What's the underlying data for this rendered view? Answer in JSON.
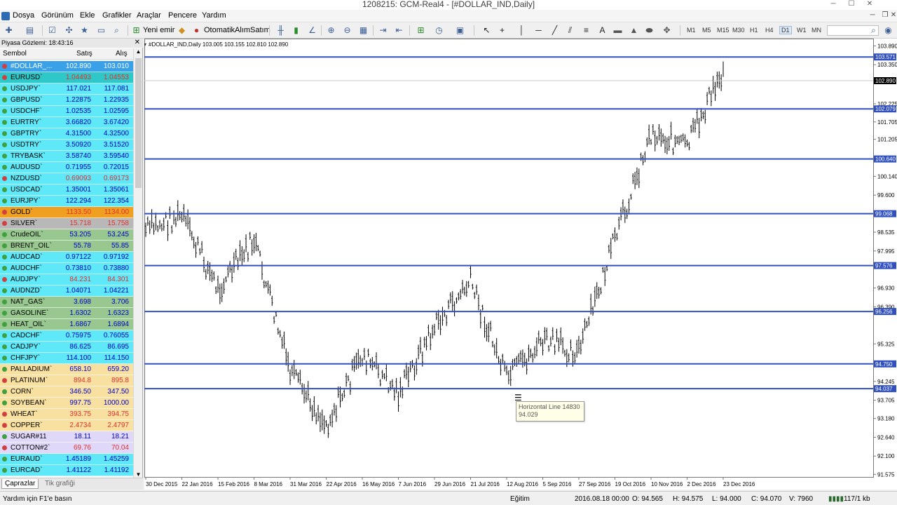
{
  "window": {
    "title": "1208215: GCM-Real4 - [#DOLLAR_IND,Daily]"
  },
  "menu": [
    "Dosya",
    "Görünüm",
    "Ekle",
    "Grafikler",
    "Araçlar",
    "Pencere",
    "Yardım"
  ],
  "toolbar": {
    "new_order": "Yeni emir",
    "auto_trading": "OtomatikAlımSatım",
    "timeframes": [
      "M1",
      "M5",
      "M15",
      "M30",
      "H1",
      "H4",
      "D1",
      "W1",
      "MN"
    ],
    "active_timeframe": "D1"
  },
  "market_watch": {
    "title": "Piyasa Gözlemi: 18:43:16",
    "columns": {
      "symbol": "Sembol",
      "bid": "Satış",
      "ask": "Alış"
    },
    "rows": [
      {
        "symbol": "#DOLLAR_...",
        "bid": "102.890",
        "ask": "103.010",
        "bg": "#3aa0e8",
        "fg": "#ffffff",
        "arrow": "#d04040"
      },
      {
        "symbol": "EURUSD`",
        "bid": "1.04493",
        "ask": "1.04553",
        "bg": "#2ec8c8",
        "fg": "#e03030",
        "arrow": "#d04040"
      },
      {
        "symbol": "USDJPY`",
        "bid": "117.021",
        "ask": "117.081",
        "bg": "#5ee8f8",
        "fg": "#0000c0",
        "arrow": "#40a040"
      },
      {
        "symbol": "GBPUSD`",
        "bid": "1.22875",
        "ask": "1.22935",
        "bg": "#5ee8f8",
        "fg": "#0000c0",
        "arrow": "#40a040"
      },
      {
        "symbol": "USDCHF`",
        "bid": "1.02535",
        "ask": "1.02595",
        "bg": "#5ee8f8",
        "fg": "#0000c0",
        "arrow": "#40a040"
      },
      {
        "symbol": "EURTRY`",
        "bid": "3.66820",
        "ask": "3.67420",
        "bg": "#5ee8f8",
        "fg": "#0000c0",
        "arrow": "#40a040"
      },
      {
        "symbol": "GBPTRY`",
        "bid": "4.31500",
        "ask": "4.32500",
        "bg": "#5ee8f8",
        "fg": "#0000c0",
        "arrow": "#40a040"
      },
      {
        "symbol": "USDTRY`",
        "bid": "3.50920",
        "ask": "3.51520",
        "bg": "#5ee8f8",
        "fg": "#0000c0",
        "arrow": "#40a040"
      },
      {
        "symbol": "TRYBASK`",
        "bid": "3.58740",
        "ask": "3.59540",
        "bg": "#5ee8f8",
        "fg": "#0000c0",
        "arrow": "#40a040"
      },
      {
        "symbol": "AUDUSD`",
        "bid": "0.71955",
        "ask": "0.72015",
        "bg": "#5ee8f8",
        "fg": "#0000c0",
        "arrow": "#40a040"
      },
      {
        "symbol": "NZDUSD`",
        "bid": "0.69093",
        "ask": "0.69173",
        "bg": "#5ee8f8",
        "fg": "#e03030",
        "arrow": "#d04040"
      },
      {
        "symbol": "USDCAD`",
        "bid": "1.35001",
        "ask": "1.35061",
        "bg": "#5ee8f8",
        "fg": "#0000c0",
        "arrow": "#40a040"
      },
      {
        "symbol": "EURJPY`",
        "bid": "122.294",
        "ask": "122.354",
        "bg": "#5ee8f8",
        "fg": "#0000c0",
        "arrow": "#40a040"
      },
      {
        "symbol": "GOLD`",
        "bid": "1133.50",
        "ask": "1134.00",
        "bg": "#f0a020",
        "fg": "#e03030",
        "arrow": "#d04040"
      },
      {
        "symbol": "SILVER`",
        "bid": "15.718",
        "ask": "15.758",
        "bg": "#b8b8b8",
        "fg": "#e03030",
        "arrow": "#d04040"
      },
      {
        "symbol": "CrudeOIL`",
        "bid": "53.205",
        "ask": "53.245",
        "bg": "#98c890",
        "fg": "#0000c0",
        "arrow": "#40a040"
      },
      {
        "symbol": "BRENT_OIL`",
        "bid": "55.78",
        "ask": "55.85",
        "bg": "#98c890",
        "fg": "#0000c0",
        "arrow": "#40a040"
      },
      {
        "symbol": "AUDCAD`",
        "bid": "0.97122",
        "ask": "0.97192",
        "bg": "#5ee8f8",
        "fg": "#0000c0",
        "arrow": "#40a040"
      },
      {
        "symbol": "AUDCHF`",
        "bid": "0.73810",
        "ask": "0.73880",
        "bg": "#5ee8f8",
        "fg": "#0000c0",
        "arrow": "#40a040"
      },
      {
        "symbol": "AUDJPY`",
        "bid": "84.231",
        "ask": "84.301",
        "bg": "#5ee8f8",
        "fg": "#e03030",
        "arrow": "#d04040"
      },
      {
        "symbol": "AUDNZD`",
        "bid": "1.04071",
        "ask": "1.04221",
        "bg": "#5ee8f8",
        "fg": "#0000c0",
        "arrow": "#40a040"
      },
      {
        "symbol": "NAT_GAS`",
        "bid": "3.698",
        "ask": "3.706",
        "bg": "#98c890",
        "fg": "#0000c0",
        "arrow": "#40a040"
      },
      {
        "symbol": "GASOLINE`",
        "bid": "1.6302",
        "ask": "1.6323",
        "bg": "#98c890",
        "fg": "#0000c0",
        "arrow": "#40a040"
      },
      {
        "symbol": "HEAT_OIL`",
        "bid": "1.6867",
        "ask": "1.6894",
        "bg": "#98c890",
        "fg": "#0000c0",
        "arrow": "#40a040"
      },
      {
        "symbol": "CADCHF`",
        "bid": "0.75975",
        "ask": "0.76055",
        "bg": "#5ee8f8",
        "fg": "#0000c0",
        "arrow": "#40a040"
      },
      {
        "symbol": "CADJPY`",
        "bid": "86.625",
        "ask": "86.695",
        "bg": "#5ee8f8",
        "fg": "#0000c0",
        "arrow": "#40a040"
      },
      {
        "symbol": "CHFJPY`",
        "bid": "114.100",
        "ask": "114.150",
        "bg": "#5ee8f8",
        "fg": "#0000c0",
        "arrow": "#40a040"
      },
      {
        "symbol": "PALLADIUM`",
        "bid": "658.10",
        "ask": "659.20",
        "bg": "#f8e0a0",
        "fg": "#0000c0",
        "arrow": "#40a040"
      },
      {
        "symbol": "PLATINUM`",
        "bid": "894.8",
        "ask": "895.8",
        "bg": "#f8e0a0",
        "fg": "#e03030",
        "arrow": "#d04040"
      },
      {
        "symbol": "CORN`",
        "bid": "346.50",
        "ask": "347.50",
        "bg": "#f8e0a0",
        "fg": "#0000c0",
        "arrow": "#40a040"
      },
      {
        "symbol": "SOYBEAN`",
        "bid": "997.75",
        "ask": "1000.00",
        "bg": "#f8e0a0",
        "fg": "#0000c0",
        "arrow": "#40a040"
      },
      {
        "symbol": "WHEAT`",
        "bid": "393.75",
        "ask": "394.75",
        "bg": "#f8e0a0",
        "fg": "#e03030",
        "arrow": "#d04040"
      },
      {
        "symbol": "COPPER`",
        "bid": "2.4734",
        "ask": "2.4797",
        "bg": "#f8e0a0",
        "fg": "#e03030",
        "arrow": "#d04040"
      },
      {
        "symbol": "SUGAR#11",
        "bid": "18.11",
        "ask": "18.21",
        "bg": "#e0d8f8",
        "fg": "#0000c0",
        "arrow": "#40a040"
      },
      {
        "symbol": "COTTON#2`",
        "bid": "69.76",
        "ask": "70.04",
        "bg": "#e0d8f8",
        "fg": "#e03030",
        "arrow": "#d04040"
      },
      {
        "symbol": "EURAUD`",
        "bid": "1.45189",
        "ask": "1.45259",
        "bg": "#5ee8f8",
        "fg": "#0000c0",
        "arrow": "#40a040"
      },
      {
        "symbol": "EURCAD`",
        "bid": "1.41122",
        "ask": "1.41192",
        "bg": "#5ee8f8",
        "fg": "#0000c0",
        "arrow": "#40a040"
      }
    ],
    "tabs": [
      "Çaprazlar",
      "Tik grafiği"
    ]
  },
  "chart": {
    "header": "#DOLLAR_IND,Daily  103.005 103.155 102.810 102.890",
    "price_label_current": "102.890",
    "horizontal_lines": [
      "103.571",
      "102.079",
      "100.640",
      "99.068",
      "97.576",
      "96.256",
      "94.750",
      "94.037"
    ],
    "price_ticks": [
      "103.890",
      "103.350",
      "102.225",
      "101.705",
      "101.205",
      "100.140",
      "99.600",
      "98.535",
      "97.995",
      "96.930",
      "96.390",
      "95.325",
      "94.245",
      "93.705",
      "93.180",
      "92.640",
      "92.100",
      "91.575"
    ],
    "date_ticks": [
      "30 Dec 2015",
      "22 Jan 2016",
      "15 Feb 2016",
      "8 Mar 2016",
      "31 Mar 2016",
      "22 Apr 2016",
      "16 May 2016",
      "7 Jun 2016",
      "29 Jun 2016",
      "21 Jul 2016",
      "12 Aug 2016",
      "5 Sep 2016",
      "27 Sep 2016",
      "19 Oct 2016",
      "10 Nov 2016",
      "2 Dec 2016",
      "23 Dec 2016"
    ],
    "tooltip": {
      "name": "Horizontal Line 14830",
      "value": "94.029"
    },
    "line_color": "#3050c0"
  },
  "chart_data": {
    "type": "line",
    "title": "#DOLLAR_IND,Daily",
    "x": [
      "30 Dec 2015",
      "22 Jan 2016",
      "15 Feb 2016",
      "8 Mar 2016",
      "31 Mar 2016",
      "22 Apr 2016",
      "16 May 2016",
      "7 Jun 2016",
      "29 Jun 2016",
      "21 Jul 2016",
      "12 Aug 2016",
      "5 Sep 2016",
      "27 Sep 2016",
      "19 Oct 2016",
      "10 Nov 2016",
      "2 Dec 2016",
      "23 Dec 2016"
    ],
    "series": [
      {
        "values": [
          98.6,
          99.0,
          96.9,
          98.3,
          94.5,
          93.0,
          95.0,
          93.9,
          95.8,
          97.1,
          94.3,
          95.4,
          95.1,
          98.3,
          101.4,
          101.0,
          103.2
        ]
      }
    ],
    "ylim": [
      91.5,
      104.1
    ]
  },
  "statusbar": {
    "help": "Yardım için F1'e basın",
    "profile": "Eğitim",
    "datetime": "2016.08.18 00:00",
    "open": "O: 94.565",
    "high": "H: 94.575",
    "low": "L: 94.000",
    "close": "C: 94.070",
    "volume": "V: 7960",
    "traffic": "117/1 kb"
  }
}
